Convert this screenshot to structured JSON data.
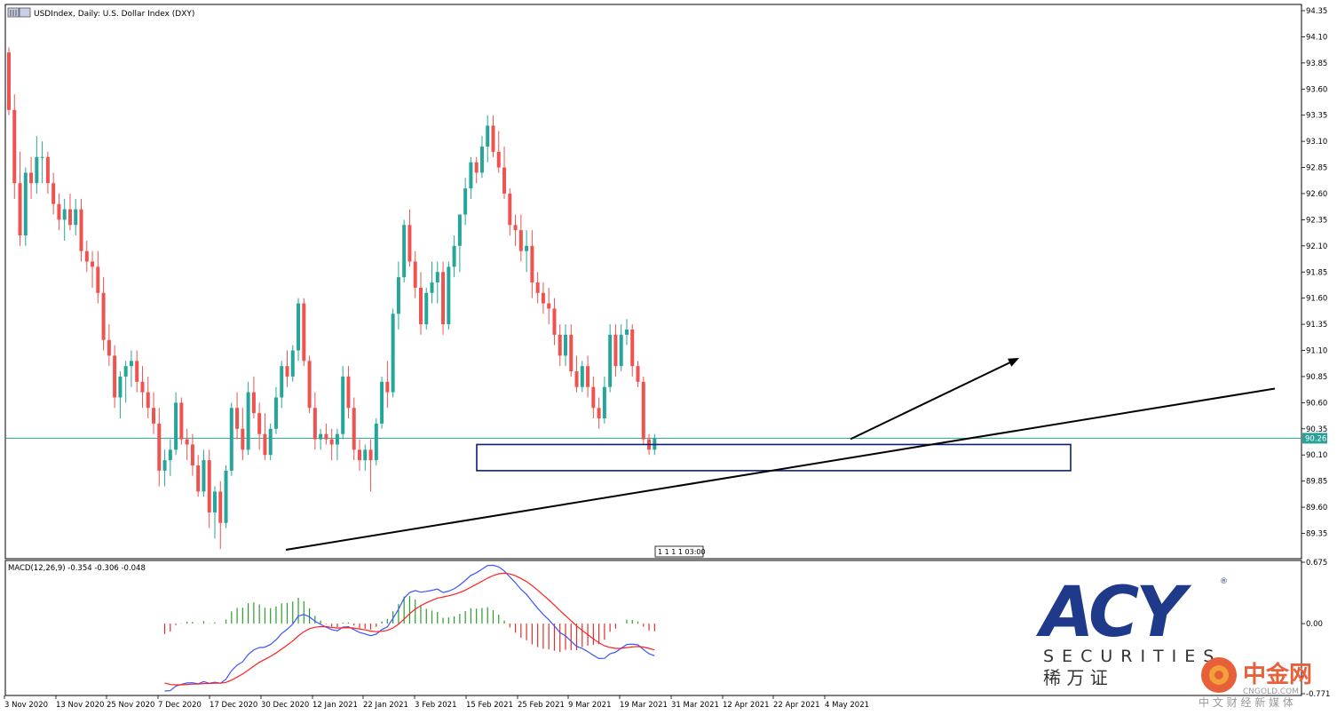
{
  "header": {
    "title": "USDIndex, Daily:  U.S. Dollar Index (DXY)"
  },
  "price_tag": "90.26",
  "time_marker": "1 1 1 1 03:00",
  "macd_label": "MACD(12,26,9) -0.354 -0.306 -0.048",
  "price_axis": {
    "labels": [
      "94.35",
      "94.10",
      "93.85",
      "93.60",
      "93.35",
      "93.10",
      "92.85",
      "92.60",
      "92.35",
      "92.10",
      "91.85",
      "91.60",
      "91.35",
      "91.10",
      "90.85",
      "90.60",
      "90.35",
      "90.10",
      "89.85",
      "89.60",
      "89.35"
    ]
  },
  "macd_axis": {
    "labels": [
      "0.675",
      "0.00",
      "-0.771"
    ]
  },
  "date_axis": {
    "labels": [
      "3 Nov 2020",
      "13 Nov 2020",
      "25 Nov 2020",
      "7 Dec 2020",
      "17 Dec 2020",
      "30 Dec 2020",
      "12 Jan 2021",
      "22 Jan 2021",
      "3 Feb 2021",
      "15 Feb 2021",
      "25 Feb 2021",
      "9 Mar 2021",
      "19 Mar 2021",
      "31 Mar 2021",
      "12 Apr 2021",
      "22 Apr 2021",
      "4 May 2021"
    ]
  },
  "logo": {
    "brand": "ACY",
    "registered": "®",
    "securities": "SECURITIES",
    "chinese": "稀  万  证",
    "watermark_cn": "中金网",
    "watermark_en": "CNGOLD.COM",
    "watermark_sub": "中 文 财 经 新 媒 体"
  },
  "colors": {
    "bull": "#26a69a",
    "bear": "#ef5350",
    "macd_line": "#3b54ff",
    "signal_line": "#ff2020",
    "current_line": "#2aa198",
    "zone_border": "#0b1e7a",
    "logo_blue": "#1f3a8a"
  },
  "chart_data": {
    "type": "candlestick",
    "symbol": "USDIndex",
    "timeframe": "Daily",
    "ylim": [
      89.2,
      94.4
    ],
    "current_price": 90.26,
    "candles": [
      [
        93.95,
        94.0,
        93.35,
        93.4
      ],
      [
        93.4,
        93.55,
        92.55,
        92.7
      ],
      [
        92.7,
        93.0,
        92.1,
        92.2
      ],
      [
        92.2,
        92.85,
        92.1,
        92.8
      ],
      [
        92.8,
        92.95,
        92.55,
        92.7
      ],
      [
        92.7,
        93.15,
        92.6,
        92.95
      ],
      [
        92.95,
        93.1,
        92.7,
        92.95
      ],
      [
        92.95,
        93.0,
        92.6,
        92.7
      ],
      [
        92.7,
        92.8,
        92.4,
        92.5
      ],
      [
        92.5,
        92.6,
        92.25,
        92.35
      ],
      [
        92.35,
        92.55,
        92.15,
        92.45
      ],
      [
        92.45,
        92.6,
        92.25,
        92.3
      ],
      [
        92.3,
        92.55,
        92.2,
        92.45
      ],
      [
        92.45,
        92.55,
        91.95,
        92.05
      ],
      [
        92.05,
        92.15,
        91.85,
        91.95
      ],
      [
        91.95,
        92.05,
        91.7,
        91.9
      ],
      [
        91.9,
        92.05,
        91.55,
        91.65
      ],
      [
        91.65,
        91.8,
        91.1,
        91.2
      ],
      [
        91.2,
        91.35,
        90.95,
        91.05
      ],
      [
        91.05,
        91.15,
        90.55,
        90.65
      ],
      [
        90.65,
        90.9,
        90.45,
        90.85
      ],
      [
        90.85,
        91.0,
        90.6,
        90.95
      ],
      [
        90.95,
        91.1,
        90.75,
        91.0
      ],
      [
        91.0,
        91.1,
        90.7,
        90.8
      ],
      [
        90.8,
        90.95,
        90.55,
        90.7
      ],
      [
        90.7,
        90.85,
        90.45,
        90.55
      ],
      [
        90.55,
        90.7,
        90.3,
        90.4
      ],
      [
        90.4,
        90.55,
        89.8,
        89.95
      ],
      [
        89.95,
        90.15,
        89.8,
        90.05
      ],
      [
        90.05,
        90.25,
        89.9,
        90.15
      ],
      [
        90.15,
        90.7,
        90.1,
        90.6
      ],
      [
        90.6,
        90.65,
        90.2,
        90.25
      ],
      [
        90.25,
        90.35,
        90.05,
        90.2
      ],
      [
        90.2,
        90.3,
        89.9,
        90.0
      ],
      [
        90.0,
        90.1,
        89.7,
        89.75
      ],
      [
        89.75,
        90.15,
        89.7,
        90.05
      ],
      [
        90.05,
        90.15,
        89.4,
        89.55
      ],
      [
        89.55,
        89.8,
        89.3,
        89.75
      ],
      [
        89.75,
        89.85,
        89.2,
        89.45
      ],
      [
        89.45,
        90.0,
        89.4,
        89.95
      ],
      [
        89.95,
        90.6,
        89.9,
        90.55
      ],
      [
        90.55,
        90.7,
        90.25,
        90.35
      ],
      [
        90.35,
        90.55,
        90.05,
        90.15
      ],
      [
        90.15,
        90.8,
        90.1,
        90.7
      ],
      [
        90.7,
        90.85,
        90.45,
        90.5
      ],
      [
        90.5,
        90.6,
        90.15,
        90.3
      ],
      [
        90.3,
        90.5,
        90.05,
        90.1
      ],
      [
        90.1,
        90.4,
        90.05,
        90.35
      ],
      [
        90.35,
        90.75,
        90.3,
        90.65
      ],
      [
        90.65,
        91.0,
        90.55,
        90.95
      ],
      [
        90.95,
        91.1,
        90.75,
        90.85
      ],
      [
        90.85,
        91.15,
        90.8,
        91.1
      ],
      [
        91.1,
        91.6,
        91.0,
        91.55
      ],
      [
        91.55,
        91.6,
        90.95,
        91.0
      ],
      [
        91.0,
        91.05,
        90.5,
        90.55
      ],
      [
        90.55,
        90.7,
        90.15,
        90.25
      ],
      [
        90.25,
        90.35,
        90.15,
        90.3
      ],
      [
        90.3,
        90.4,
        90.2,
        90.25
      ],
      [
        90.25,
        90.35,
        90.05,
        90.2
      ],
      [
        90.2,
        90.35,
        90.05,
        90.3
      ],
      [
        90.3,
        90.95,
        90.25,
        90.85
      ],
      [
        90.85,
        90.95,
        90.45,
        90.55
      ],
      [
        90.55,
        90.65,
        90.05,
        90.15
      ],
      [
        90.15,
        90.25,
        89.95,
        90.05
      ],
      [
        90.05,
        90.2,
        89.95,
        90.15
      ],
      [
        90.15,
        90.25,
        89.75,
        90.05
      ],
      [
        90.05,
        90.45,
        90.0,
        90.4
      ],
      [
        90.4,
        90.85,
        90.35,
        90.8
      ],
      [
        90.8,
        91.0,
        90.55,
        90.7
      ],
      [
        90.7,
        91.5,
        90.65,
        91.45
      ],
      [
        91.45,
        91.95,
        91.3,
        91.8
      ],
      [
        91.8,
        92.35,
        91.75,
        92.3
      ],
      [
        92.3,
        92.45,
        91.9,
        91.95
      ],
      [
        91.95,
        92.05,
        91.6,
        91.7
      ],
      [
        91.7,
        91.85,
        91.25,
        91.35
      ],
      [
        91.35,
        91.7,
        91.3,
        91.65
      ],
      [
        91.65,
        91.95,
        91.55,
        91.75
      ],
      [
        91.75,
        91.95,
        91.55,
        91.85
      ],
      [
        91.85,
        91.95,
        91.25,
        91.35
      ],
      [
        91.35,
        91.95,
        91.3,
        91.9
      ],
      [
        91.9,
        92.2,
        91.8,
        92.1
      ],
      [
        92.1,
        92.35,
        91.85,
        92.4
      ],
      [
        92.4,
        92.75,
        92.3,
        92.65
      ],
      [
        92.65,
        92.95,
        92.55,
        92.9
      ],
      [
        92.9,
        92.95,
        92.7,
        92.8
      ],
      [
        92.8,
        93.15,
        92.75,
        93.05
      ],
      [
        93.05,
        93.35,
        92.9,
        93.25
      ],
      [
        93.25,
        93.35,
        92.95,
        93.0
      ],
      [
        93.0,
        93.2,
        92.8,
        92.85
      ],
      [
        92.85,
        93.05,
        92.55,
        92.6
      ],
      [
        92.6,
        92.65,
        92.2,
        92.3
      ],
      [
        92.3,
        92.4,
        92.1,
        92.25
      ],
      [
        92.25,
        92.4,
        91.95,
        92.05
      ],
      [
        92.05,
        92.25,
        91.85,
        92.1
      ],
      [
        92.1,
        92.25,
        91.6,
        91.75
      ],
      [
        91.75,
        91.85,
        91.55,
        91.65
      ],
      [
        91.65,
        91.75,
        91.45,
        91.55
      ],
      [
        91.55,
        91.7,
        91.35,
        91.5
      ],
      [
        91.5,
        91.6,
        91.15,
        91.25
      ],
      [
        91.25,
        91.35,
        90.95,
        91.05
      ],
      [
        91.05,
        91.35,
        90.95,
        91.25
      ],
      [
        91.25,
        91.35,
        90.85,
        90.9
      ],
      [
        90.9,
        91.05,
        90.7,
        90.75
      ],
      [
        90.75,
        91.0,
        90.7,
        90.95
      ],
      [
        90.95,
        91.05,
        90.65,
        90.75
      ],
      [
        90.75,
        90.85,
        90.45,
        90.55
      ],
      [
        90.55,
        90.65,
        90.35,
        90.45
      ],
      [
        90.45,
        90.85,
        90.4,
        90.75
      ],
      [
        90.75,
        91.35,
        90.7,
        91.25
      ],
      [
        91.25,
        91.35,
        90.85,
        90.95
      ],
      [
        90.95,
        91.35,
        90.9,
        91.25
      ],
      [
        91.25,
        91.4,
        91.15,
        91.3
      ],
      [
        91.3,
        91.35,
        90.85,
        90.95
      ],
      [
        90.95,
        91.0,
        90.75,
        90.8
      ],
      [
        90.8,
        90.85,
        90.2,
        90.25
      ],
      [
        90.25,
        90.3,
        90.1,
        90.15
      ],
      [
        90.15,
        90.3,
        90.1,
        90.26
      ]
    ],
    "trendline": {
      "from": [
        38,
        89.2
      ],
      "to": [
        "2021-05-31",
        90.65
      ]
    },
    "arrow": {
      "from": [
        116,
        90.26
      ],
      "to": [
        "projection",
        91.05
      ]
    },
    "zone": {
      "top": 90.2,
      "bottom": 89.95
    },
    "macd": {
      "params": "12,26,9",
      "last": [
        -0.354,
        -0.306,
        -0.048
      ],
      "ylim": [
        -0.771,
        0.675
      ]
    }
  }
}
